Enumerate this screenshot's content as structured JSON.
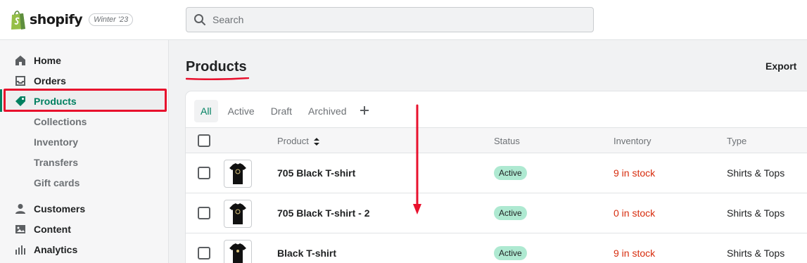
{
  "topbar": {
    "brand": "shopify",
    "edition": "Winter '23",
    "search_placeholder": "Search"
  },
  "sidebar": {
    "items": [
      {
        "label": "Home",
        "icon": "home-icon"
      },
      {
        "label": "Orders",
        "icon": "inbox-icon"
      },
      {
        "label": "Products",
        "icon": "tag-icon",
        "active": true
      },
      {
        "label": "Customers",
        "icon": "person-icon"
      },
      {
        "label": "Content",
        "icon": "image-icon"
      },
      {
        "label": "Analytics",
        "icon": "bar-chart-icon"
      }
    ],
    "sub_items": [
      "Collections",
      "Inventory",
      "Transfers",
      "Gift cards"
    ]
  },
  "main": {
    "title": "Products",
    "export_label": "Export",
    "tabs": [
      "All",
      "Active",
      "Draft",
      "Archived"
    ],
    "table": {
      "columns": [
        "Product",
        "Status",
        "Inventory",
        "Type"
      ],
      "rows": [
        {
          "name": "705 Black T-shirt",
          "status": "Active",
          "inventory": "9 in stock",
          "type": "Shirts & Tops"
        },
        {
          "name": "705 Black T-shirt - 2",
          "status": "Active",
          "inventory": "0 in stock",
          "type": "Shirts & Tops"
        },
        {
          "name": "Black T-shirt",
          "status": "Active",
          "inventory": "9 in stock",
          "type": "Shirts & Tops"
        }
      ]
    }
  },
  "colors": {
    "accent": "#008060",
    "annotation_red": "#e8112d",
    "status_active_bg": "#aee9d1",
    "stock_critical": "#d72c0d"
  }
}
